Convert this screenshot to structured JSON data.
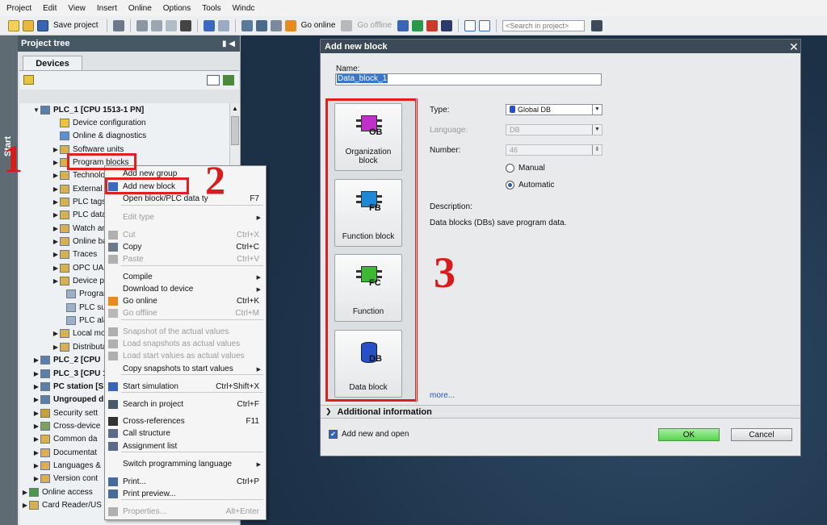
{
  "menubar": {
    "items": [
      "Project",
      "Edit",
      "View",
      "Insert",
      "Online",
      "Options",
      "Tools",
      "Windc"
    ]
  },
  "toolbar": {
    "save_project": "Save project",
    "go_online": "Go online",
    "go_offline": "Go offline",
    "search_placeholder": "<Search in project>"
  },
  "side_tab": {
    "label": "Start"
  },
  "project_tree": {
    "title": "Project tree",
    "tab": "Devices",
    "items": [
      {
        "label": "PLC_1 [CPU 1513-1 PN]",
        "bold": true
      },
      {
        "label": "Device configuration"
      },
      {
        "label": "Online & diagnostics"
      },
      {
        "label": "Software units"
      },
      {
        "label": "Program blocks"
      },
      {
        "label": "Technolo"
      },
      {
        "label": "External s"
      },
      {
        "label": "PLC tags"
      },
      {
        "label": "PLC data"
      },
      {
        "label": "Watch an"
      },
      {
        "label": "Online ba"
      },
      {
        "label": "Traces"
      },
      {
        "label": "OPC UA c"
      },
      {
        "label": "Device pr"
      },
      {
        "label": "Program"
      },
      {
        "label": "PLC supe"
      },
      {
        "label": "PLC alarm"
      },
      {
        "label": "Local mo"
      },
      {
        "label": "Distributa"
      },
      {
        "label": "PLC_2 [CPU",
        "bold": true
      },
      {
        "label": "PLC_3 [CPU 1",
        "bold": true
      },
      {
        "label": "PC station [S",
        "bold": true
      },
      {
        "label": "Ungrouped d",
        "bold": true
      },
      {
        "label": "Security sett"
      },
      {
        "label": "Cross-device"
      },
      {
        "label": "Common da"
      },
      {
        "label": "Documentat"
      },
      {
        "label": "Languages &"
      },
      {
        "label": "Version cont"
      },
      {
        "label": "Online access"
      },
      {
        "label": "Card Reader/US"
      }
    ]
  },
  "context_menu": {
    "items": [
      {
        "label": "Add new group",
        "shortcut": ""
      },
      {
        "label": "Add new block",
        "shortcut": ""
      },
      {
        "label": "Open block/PLC data ty",
        "shortcut": "F7"
      },
      {
        "label": "Edit type",
        "shortcut": ""
      },
      {
        "label": "Cut",
        "shortcut": "Ctrl+X"
      },
      {
        "label": "Copy",
        "shortcut": "Ctrl+C"
      },
      {
        "label": "Paste",
        "shortcut": "Ctrl+V"
      },
      {
        "label": "Compile",
        "shortcut": ""
      },
      {
        "label": "Download to device",
        "shortcut": ""
      },
      {
        "label": "Go online",
        "shortcut": "Ctrl+K"
      },
      {
        "label": "Go offline",
        "shortcut": "Ctrl+M"
      },
      {
        "label": "Snapshot of the actual values",
        "shortcut": ""
      },
      {
        "label": "Load snapshots as actual values",
        "shortcut": ""
      },
      {
        "label": "Load start values as actual values",
        "shortcut": ""
      },
      {
        "label": "Copy snapshots to start values",
        "shortcut": ""
      },
      {
        "label": "Start simulation",
        "shortcut": "Ctrl+Shift+X"
      },
      {
        "label": "Search in project",
        "shortcut": "Ctrl+F"
      },
      {
        "label": "Cross-references",
        "shortcut": "F11"
      },
      {
        "label": "Call structure",
        "shortcut": ""
      },
      {
        "label": "Assignment list",
        "shortcut": ""
      },
      {
        "label": "Switch programming language",
        "shortcut": ""
      },
      {
        "label": "Print...",
        "shortcut": "Ctrl+P"
      },
      {
        "label": "Print preview...",
        "shortcut": ""
      },
      {
        "label": "Properties...",
        "shortcut": "Alt+Enter"
      }
    ]
  },
  "dialog": {
    "title": "Add new block",
    "name_label": "Name:",
    "name_value": "Data_block_1",
    "blocks": [
      {
        "code": "OB",
        "label": "Organization block",
        "color": "#c030c8"
      },
      {
        "code": "FB",
        "label": "Function block",
        "color": "#1e88d8"
      },
      {
        "code": "FC",
        "label": "Function",
        "color": "#3cb832"
      },
      {
        "code": "DB",
        "label": "Data block",
        "color": "#2750c8"
      }
    ],
    "type_label": "Type:",
    "type_value": "Global DB",
    "language_label": "Language:",
    "language_value": "DB",
    "number_label": "Number:",
    "number_value": "46",
    "manual_label": "Manual",
    "automatic_label": "Automatic",
    "description_label": "Description:",
    "description_text": "Data blocks (DBs) save program data.",
    "more_link": "more...",
    "additional_info": "Additional information",
    "add_and_open": "Add new and open",
    "ok": "OK",
    "cancel": "Cancel"
  },
  "annotations": {
    "step1": "1",
    "step2": "2",
    "step3": "3"
  },
  "colors": {
    "annotation_red": "#e0201f",
    "title_bar": "#3b4a56",
    "ok_green": "#58d34c"
  }
}
